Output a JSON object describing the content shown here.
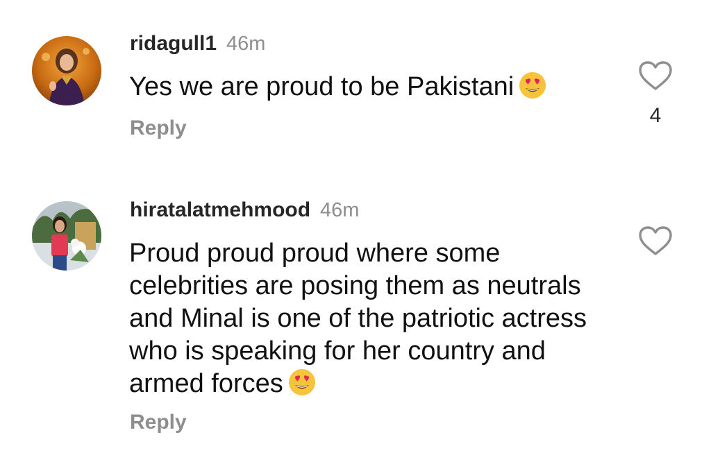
{
  "comments": [
    {
      "username": "ridagull1",
      "time": "46m",
      "text": "Yes we are proud to be Pakistani",
      "emoji": "heart-eyes-emoji",
      "reply_label": "Reply",
      "like_count": "4",
      "icon": "heart-outline-icon"
    },
    {
      "username": "hiratalatmehmood",
      "time": "46m",
      "text": "Proud proud proud where some celebrities are posing them as neutrals and Minal is one of the patriotic actress who is speaking for her country and armed forces",
      "emoji": "heart-eyes-emoji",
      "reply_label": "Reply",
      "icon": "heart-outline-icon"
    }
  ],
  "colors": {
    "text": "#111111",
    "username": "#262626",
    "muted": "#8e8e8e",
    "emoji_face": "#f6c33b",
    "emoji_heart": "#e0245e"
  }
}
